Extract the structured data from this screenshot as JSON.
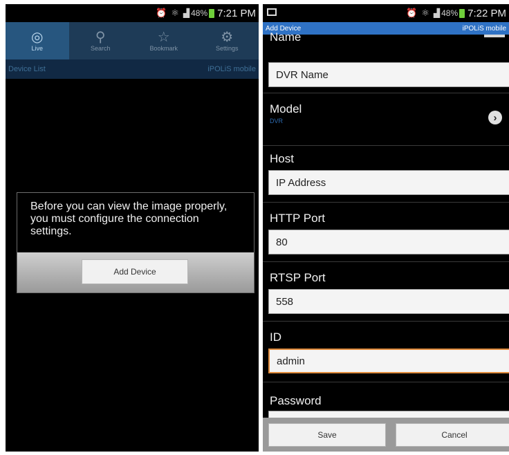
{
  "left": {
    "status": {
      "time": "7:21 PM",
      "battery": "48%"
    },
    "tabs": [
      {
        "label": "Live",
        "icon": "camera-icon"
      },
      {
        "label": "Search",
        "icon": "search-icon"
      },
      {
        "label": "Bookmark",
        "icon": "star-icon"
      },
      {
        "label": "Settings",
        "icon": "gear-icon"
      }
    ],
    "subheader": {
      "title": "Device List",
      "brand": "iPOLiS mobile"
    },
    "dialog": {
      "message": "Before you can view the image properly, you must configure the connection settings.",
      "button": "Add Device"
    }
  },
  "right": {
    "status": {
      "time": "7:22 PM",
      "battery": "48%"
    },
    "header": {
      "title": "Add Device",
      "brand": "iPOLiS mobile"
    },
    "form": {
      "name_label": "Name",
      "name_value": "DVR Name",
      "model_label": "Model",
      "model_value": "DVR",
      "host_label": "Host",
      "host_value": "IP Address",
      "http_label": "HTTP Port",
      "http_value": "80",
      "rtsp_label": "RTSP Port",
      "rtsp_value": "558",
      "id_label": "ID",
      "id_value": "admin",
      "password_label": "Password"
    },
    "buttons": {
      "save": "Save",
      "cancel": "Cancel"
    }
  },
  "colors": {
    "tab_bar": "#1e3b57",
    "tab_active": "#27567f",
    "header_blue": "#2f72c5",
    "focus_orange": "#e08a3a",
    "battery_green": "#6fcf3a"
  }
}
